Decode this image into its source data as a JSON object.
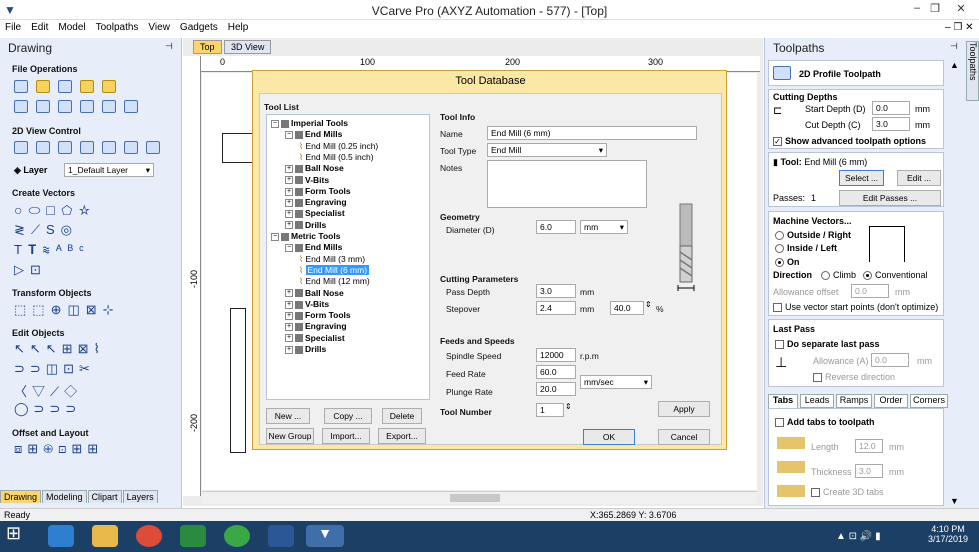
{
  "window": {
    "title": "VCarve Pro (AXYZ Automation - 577) - [Top]",
    "min": "–",
    "max": "❐",
    "close": "✕"
  },
  "menu": [
    "File",
    "Edit",
    "Model",
    "Toolpaths",
    "View",
    "Gadgets",
    "Help"
  ],
  "left": {
    "header": "Drawing",
    "sections": {
      "file_ops": "File Operations",
      "view_ctrl": "2D View Control",
      "layer_label": "Layer",
      "layer_value": "1_Default Layer",
      "create_vectors": "Create Vectors",
      "transform": "Transform Objects",
      "edit": "Edit Objects",
      "offset": "Offset and Layout"
    },
    "tabs": [
      "Drawing",
      "Modeling",
      "Clipart",
      "Layers"
    ]
  },
  "view": {
    "tabs": [
      "Top",
      "3D View"
    ],
    "ruler_h": [
      "0",
      "100",
      "200",
      "300"
    ],
    "ruler_v": [
      "-100",
      "-200"
    ]
  },
  "dialog": {
    "title": "Tool Database",
    "tool_list_label": "Tool List",
    "tree": [
      {
        "label": "Imperial Tools",
        "level": 0,
        "bold": true,
        "expanded": true
      },
      {
        "label": "End Mills",
        "level": 1,
        "bold": true,
        "expanded": true
      },
      {
        "label": "End Mill (0.25 inch)",
        "level": 2,
        "bold": false
      },
      {
        "label": "End Mill (0.5 inch)",
        "level": 2,
        "bold": false
      },
      {
        "label": "Ball Nose",
        "level": 1,
        "bold": true
      },
      {
        "label": "V-Bits",
        "level": 1,
        "bold": true
      },
      {
        "label": "Form Tools",
        "level": 1,
        "bold": true
      },
      {
        "label": "Engraving",
        "level": 1,
        "bold": true
      },
      {
        "label": "Specialist",
        "level": 1,
        "bold": true
      },
      {
        "label": "Drills",
        "level": 1,
        "bold": true
      },
      {
        "label": "Metric Tools",
        "level": 0,
        "bold": true,
        "expanded": true
      },
      {
        "label": "End Mills",
        "level": 1,
        "bold": true,
        "expanded": true
      },
      {
        "label": "End Mill (3 mm)",
        "level": 2,
        "bold": false
      },
      {
        "label": "End Mill (6 mm)",
        "level": 2,
        "bold": false,
        "selected": true
      },
      {
        "label": "End Mill (12 mm)",
        "level": 2,
        "bold": false
      },
      {
        "label": "Ball Nose",
        "level": 1,
        "bold": true
      },
      {
        "label": "V-Bits",
        "level": 1,
        "bold": true
      },
      {
        "label": "Form Tools",
        "level": 1,
        "bold": true
      },
      {
        "label": "Engraving",
        "level": 1,
        "bold": true
      },
      {
        "label": "Specialist",
        "level": 1,
        "bold": true
      },
      {
        "label": "Drills",
        "level": 1,
        "bold": true
      }
    ],
    "buttons": {
      "new": "New ...",
      "copy": "Copy ...",
      "delete": "Delete",
      "new_group": "New Group",
      "import": "Import...",
      "export": "Export...",
      "ok": "OK",
      "cancel": "Cancel",
      "apply": "Apply"
    },
    "tool_info": {
      "header": "Tool Info",
      "name_label": "Name",
      "name_value": "End Mill (6 mm)",
      "type_label": "Tool Type",
      "type_value": "End Mill",
      "notes_label": "Notes"
    },
    "geometry": {
      "header": "Geometry",
      "diameter_label": "Diameter (D)",
      "diameter_value": "6.0",
      "units": "mm"
    },
    "cutting": {
      "header": "Cutting Parameters",
      "pass_depth_label": "Pass Depth",
      "pass_depth_value": "3.0",
      "pass_unit": "mm",
      "stepover_label": "Stepover",
      "stepover_value": "2.4",
      "stepover_unit": "mm",
      "stepover_pct": "40.0",
      "pct": "%"
    },
    "feeds": {
      "header": "Feeds and Speeds",
      "spindle_label": "Spindle Speed",
      "spindle_value": "12000",
      "spindle_unit": "r.p.m",
      "feed_label": "Feed Rate",
      "feed_value": "60.0",
      "rate_units": "mm/sec",
      "plunge_label": "Plunge Rate",
      "plunge_value": "20.0"
    },
    "tool_number": {
      "label": "Tool Number",
      "value": "1"
    }
  },
  "right": {
    "header": "Toolpaths",
    "side_tab": "Toolpaths",
    "title": "2D Profile Toolpath",
    "cutting_depths": {
      "header": "Cutting Depths",
      "start_label": "Start Depth (D)",
      "start_value": "0.0",
      "cut_label": "Cut Depth (C)",
      "cut_value": "3.0",
      "unit": "mm",
      "advanced": "Show advanced toolpath options"
    },
    "tool": {
      "label": "Tool:",
      "value": "End Mill (6 mm)",
      "select": "Select ...",
      "edit": "Edit ...",
      "passes_label": "Passes:",
      "passes_value": "1",
      "edit_passes": "Edit Passes ..."
    },
    "machine_vectors": {
      "header": "Machine Vectors...",
      "outside": "Outside / Right",
      "inside": "Inside / Left",
      "on": "On",
      "direction": "Direction",
      "climb": "Climb",
      "conventional": "Conventional",
      "allowance_label": "Allowance offset",
      "allowance_value": "0.0",
      "allowance_unit": "mm",
      "start_points": "Use vector start points (don't optimize)"
    },
    "last_pass": {
      "header": "Last Pass",
      "separate": "Do separate last pass",
      "allowance_label": "Allowance (A)",
      "allowance_value": "0.0",
      "unit": "mm",
      "reverse": "Reverse direction"
    },
    "tabs": [
      "Tabs",
      "Leads",
      "Ramps",
      "Order",
      "Corners"
    ],
    "tabs_panel": {
      "add": "Add tabs to toolpath",
      "length_label": "Length",
      "length_value": "12.0",
      "thickness_label": "Thickness",
      "thickness_value": "3.0",
      "unit": "mm",
      "create3d": "Create 3D tabs"
    }
  },
  "status": {
    "left": "Ready",
    "coords": "X:365.2869 Y: 3.6706"
  },
  "taskbar": {
    "time": "4:10 PM",
    "date": "3/17/2019"
  }
}
